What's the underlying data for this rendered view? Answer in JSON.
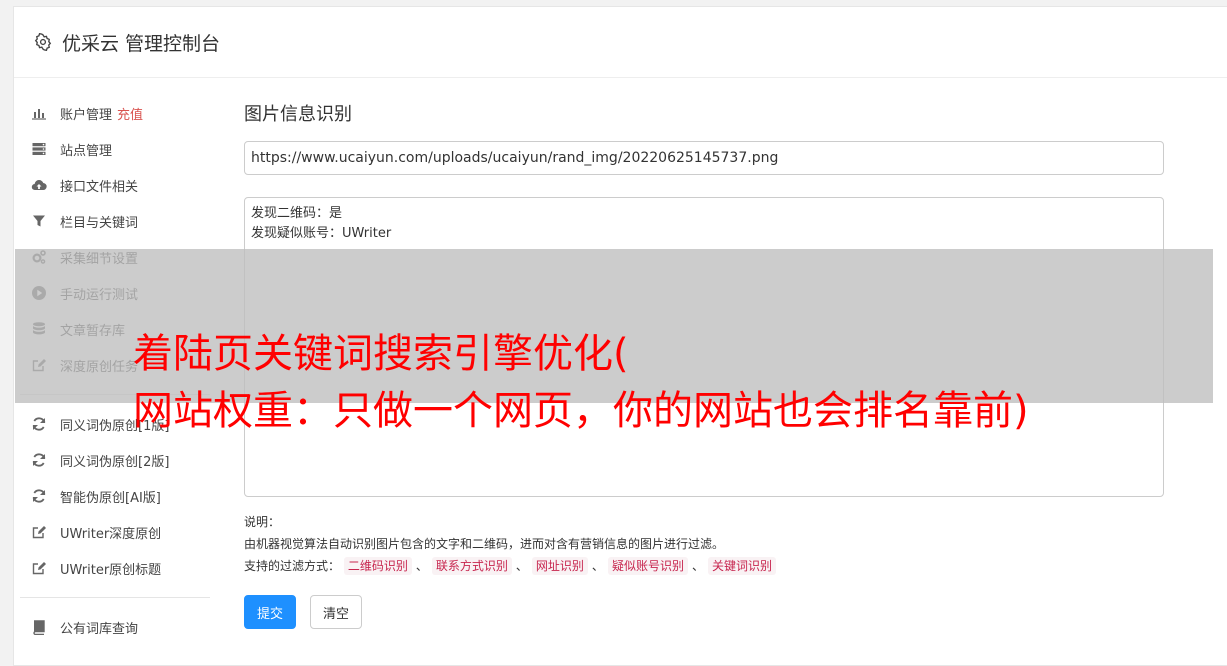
{
  "header": {
    "title": "优采云 管理控制台",
    "icon": "gear-icon"
  },
  "sidebar": {
    "groups": [
      [
        {
          "label": "账户管理",
          "icon": "bar-chart-icon",
          "badge": "充值"
        },
        {
          "label": "站点管理",
          "icon": "server-icon"
        },
        {
          "label": "接口文件相关",
          "icon": "cloud-upload-icon"
        },
        {
          "label": "栏目与关键词",
          "icon": "filter-icon"
        },
        {
          "label": "采集细节设置",
          "icon": "cogs-icon"
        },
        {
          "label": "手动运行测试",
          "icon": "play-circle-icon"
        },
        {
          "label": "文章暂存库",
          "icon": "database-icon"
        },
        {
          "label": "深度原创任务",
          "icon": "edit-icon"
        }
      ],
      [
        {
          "label": "同义词伪原创[1版]",
          "icon": "refresh-icon"
        },
        {
          "label": "同义词伪原创[2版]",
          "icon": "refresh-icon"
        },
        {
          "label": "智能伪原创[AI版]",
          "icon": "refresh-icon"
        },
        {
          "label": "UWriter深度原创",
          "icon": "edit-icon"
        },
        {
          "label": "UWriter原创标题",
          "icon": "edit-icon"
        }
      ],
      [
        {
          "label": "公有词库查询",
          "icon": "book-icon"
        }
      ]
    ]
  },
  "main": {
    "title": "图片信息识别",
    "url_value": "https://www.ucaiyun.com/uploads/ucaiyun/rand_img/20220625145737.png",
    "result_lines": [
      "发现二维码：是",
      "发现疑似账号：UWriter"
    ],
    "note_title": "说明：",
    "note_desc": "由机器视觉算法自动识别图片包含的文字和二维码，进而对含有营销信息的图片进行过滤。",
    "filter_label": "支持的过滤方式：",
    "filter_tags": [
      "二维码识别",
      "联系方式识别",
      "网址识别",
      "疑似账号识别",
      "关键词识别"
    ],
    "filter_sep": "、",
    "submit_label": "提交",
    "clear_label": "清空"
  },
  "overlay": {
    "line1": "着陆页关键词搜索引擎优化(",
    "line2": "网站权重：只做一个网页，你的网站也会排名靠前)",
    "color": "#ff0000"
  }
}
